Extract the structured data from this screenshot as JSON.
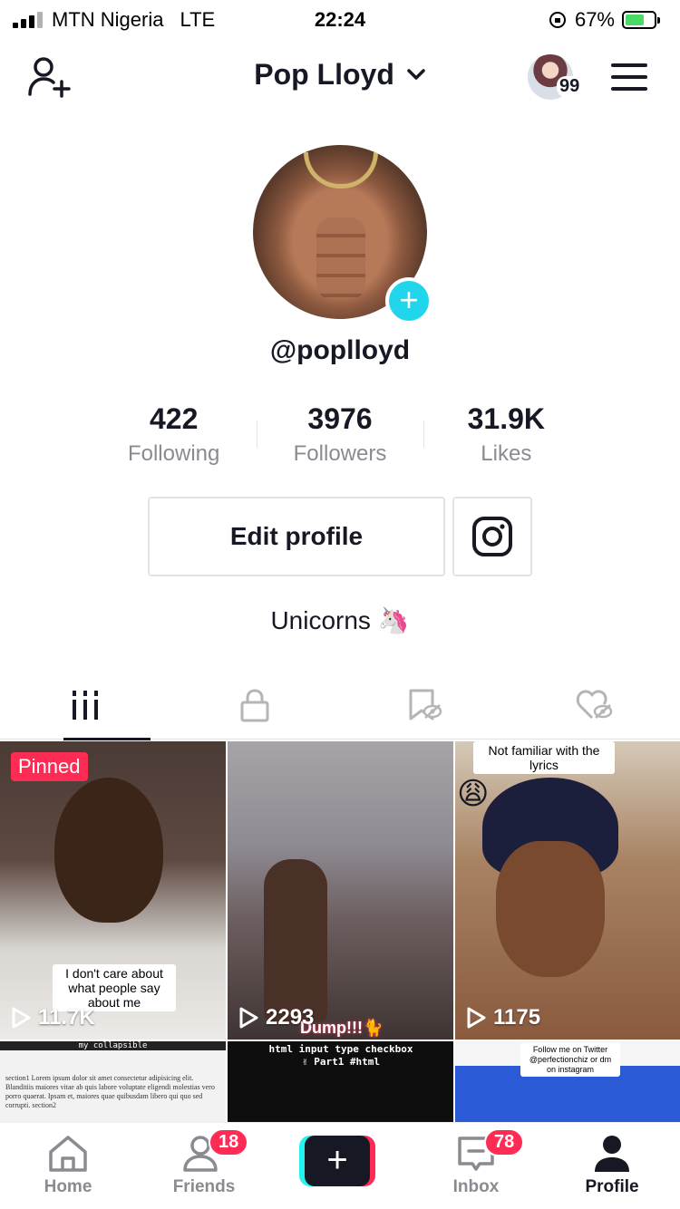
{
  "status_bar": {
    "carrier": "MTN Nigeria",
    "network": "LTE",
    "time": "22:24",
    "battery": "67%"
  },
  "header": {
    "account_name": "Pop Lloyd",
    "notification_count": "99"
  },
  "profile": {
    "handle": "@poplloyd",
    "stats": [
      {
        "value": "422",
        "label": "Following"
      },
      {
        "value": "3976",
        "label": "Followers"
      },
      {
        "value": "31.9K",
        "label": "Likes"
      }
    ],
    "edit_label": "Edit profile",
    "bio": "Unicorns 🦄"
  },
  "videos": [
    {
      "badge": "Pinned",
      "caption": "I don't care about what people say about me",
      "views": "11.7K"
    },
    {
      "caption": "Dump!!!🐈",
      "views": "2293"
    },
    {
      "caption": "Not familiar with the lyrics",
      "views": "1175"
    },
    {
      "caption": "my collapsible",
      "text": "section1 Lorem ipsum dolor sit amet consectetur adipisicing elit. Blanditiis maiores vitae ab quis labore voluptate eligendi molestias vero porro quaerat. Ipsam et, maiores quae quibusdam libero qui quo sed corrupti. section2"
    },
    {
      "caption": "html input type checkbox ✌ Part1 #html"
    },
    {
      "caption": "Follow me on Twitter @perfectionchiz or dm on instagram"
    }
  ],
  "bottom_nav": [
    {
      "label": "Home"
    },
    {
      "label": "Friends",
      "badge": "18"
    },
    {
      "label": ""
    },
    {
      "label": "Inbox",
      "badge": "78"
    },
    {
      "label": "Profile"
    }
  ],
  "colors": {
    "brand_red": "#fe2c55",
    "brand_cyan": "#25f4ee",
    "text_primary": "#161823",
    "text_secondary": "#8a8b91"
  }
}
